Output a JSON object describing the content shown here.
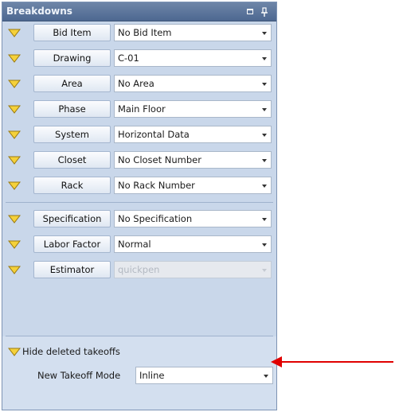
{
  "panel": {
    "title": "Breakdowns",
    "title_icons": [
      "restore-icon",
      "pin-icon"
    ]
  },
  "rows_group1": [
    {
      "button": "Bid Item",
      "value": "No Bid Item"
    },
    {
      "button": "Drawing",
      "value": "C-01"
    },
    {
      "button": "Area",
      "value": "No Area"
    },
    {
      "button": "Phase",
      "value": "Main Floor"
    },
    {
      "button": "System",
      "value": "Horizontal Data"
    },
    {
      "button": "Closet",
      "value": "No Closet Number"
    },
    {
      "button": "Rack",
      "value": "No Rack Number"
    }
  ],
  "rows_group2": [
    {
      "button": "Specification",
      "value": "No Specification"
    },
    {
      "button": "Labor Factor",
      "value": "Normal"
    },
    {
      "button": "Estimator",
      "value": "quickpen",
      "disabled": true
    }
  ],
  "options": {
    "hide_deleted": "Hide deleted takeoffs",
    "mode_label": "New Takeoff Mode",
    "mode_value": "Inline"
  },
  "colors": {
    "triangle_fill": "#f5d13a",
    "annotation_arrow": "#e00000",
    "title_bar": "#5a7399"
  }
}
